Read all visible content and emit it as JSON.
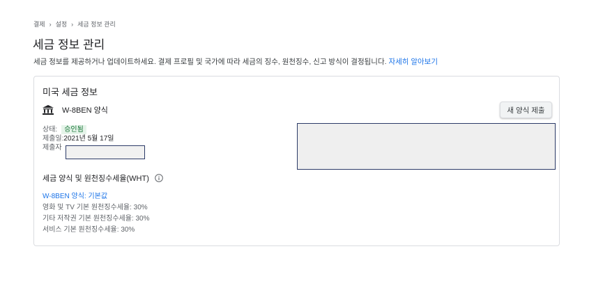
{
  "breadcrumb": [
    "결제",
    "설정",
    "세금 정보 관리"
  ],
  "breadcrumb_sep": "›",
  "page_title": "세금 정보 관리",
  "intro": {
    "text": "세금 정보를 제공하거나 업데이트하세요. 결제 프로필 및 국가에 따라 세금의 징수, 원천징수, 신고 방식이 결정됩니다. ",
    "link": "자세히 알아보기"
  },
  "card": {
    "title": "미국 세금 정보",
    "form_name": "W-8BEN 양식",
    "submit_button": "새 양식 제출",
    "status_label": "상태:",
    "status_value": "승인됨",
    "submitted_label": "제출일:",
    "submitted_value": "2021년 5월 17일",
    "submitter_label": "제출자"
  },
  "wht": {
    "title": "세금 양식 및 원천징수세율(WHT)",
    "default_link": "W-8BEN 양식: 기본값",
    "rates": [
      "영화 및 TV 기본 원천징수세율: 30%",
      "기타 저작권 기본 원천징수세율: 30%",
      "서비스 기본 원천징수세율: 30%"
    ]
  },
  "colors": {
    "accent": "#1a73e8",
    "approved_bg": "#e6f4ea",
    "approved_text": "#137333"
  },
  "icons": [
    "bank-icon",
    "info-icon"
  ]
}
